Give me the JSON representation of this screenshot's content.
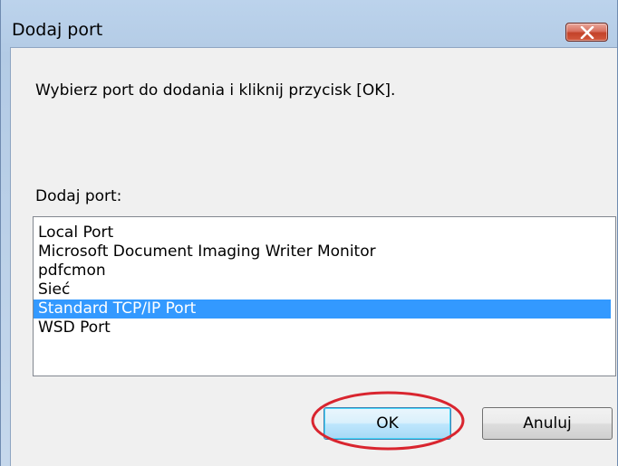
{
  "window": {
    "title": "Dodaj port",
    "close_icon": "close-x-icon"
  },
  "dialog": {
    "instruction": "Wybierz port do dodania i kliknij przycisk [OK].",
    "list_label": "Dodaj port:",
    "ports": [
      "Local Port",
      "Microsoft Document Imaging Writer Monitor",
      "pdfcmon",
      "Sieć",
      "Standard TCP/IP Port",
      "WSD Port"
    ],
    "selected_port": "Standard TCP/IP Port"
  },
  "buttons": {
    "ok_label": "OK",
    "cancel_label": "Anuluj"
  },
  "colors": {
    "selection": "#3399ff",
    "annotation_circle": "#d9252f",
    "close_button": "#c34229"
  }
}
